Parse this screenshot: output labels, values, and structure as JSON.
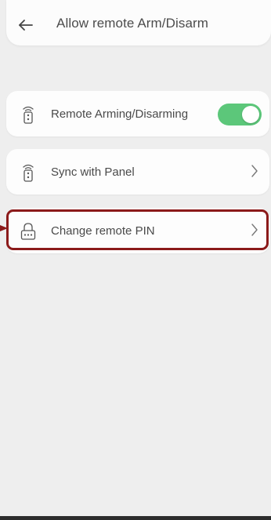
{
  "header": {
    "title": "Allow remote Arm/Disarm"
  },
  "items": [
    {
      "label": "Remote Arming/Disarming",
      "icon": "remote-control-icon",
      "control": "toggle",
      "toggle_on": true
    },
    {
      "label": "Sync with Panel",
      "icon": "remote-control-icon",
      "control": "chevron"
    },
    {
      "label": "Change remote PIN",
      "icon": "lock-pin-icon",
      "control": "chevron"
    }
  ],
  "colors": {
    "toggle_on": "#5cc77a",
    "highlight": "#8b1a1a",
    "background": "#eeeeee",
    "card": "#fdfdfd"
  }
}
